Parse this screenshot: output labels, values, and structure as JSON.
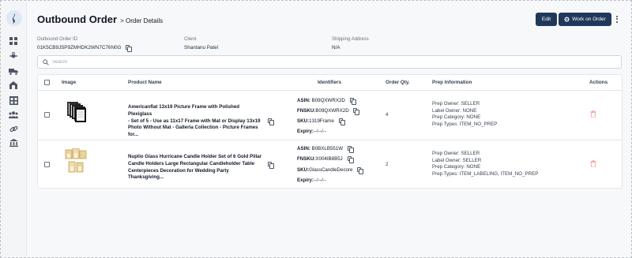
{
  "header": {
    "title": "Outbound Order",
    "subtitle": "> Order Details",
    "edit_label": "Edit",
    "work_label": "Work on Order"
  },
  "info": {
    "order_id_label": "Outbound Order ID",
    "order_id": "01K5CB9JSP9ZMHDK2WN7C76N0G",
    "client_label": "Client",
    "client": "Shantanu Patel",
    "address_label": "Shipping Address",
    "address": "N/A"
  },
  "search": {
    "placeholder": "Search"
  },
  "table": {
    "columns": [
      "Image",
      "Product Name",
      "Identifiers",
      "Order Qty.",
      "Prep Information",
      "Actions"
    ],
    "rows": [
      {
        "name_lines": [
          "Americanflat 13x19 Picture Frame with Polished Plexiglass",
          "- Set of 5 - Use as 11x17 Frame with Mat or Display 13x19",
          "Photo Without Mat - Galleria Collection - Picture Frames for..."
        ],
        "asin_label": "ASIN:",
        "asin": "B09QXWRX2D",
        "fnsku_label": "FNSKU:",
        "fnsku": "B09QXWRX2D",
        "sku_label": "SKU:",
        "sku": "1319Frame",
        "expiry_label": "Expiry:",
        "expiry": "--/--/--",
        "qty": "4",
        "prep": [
          "Prep Owner: SELLER",
          "Label Owner: NONE",
          "Prep Category: NONE",
          "Prep Types: ITEM_NO_PREP"
        ]
      },
      {
        "name_lines": [
          "Nuptio Glass Hurricane Candle Holder Set of 6 Gold Pillar",
          "Candle Holders Large Rectangular Candleholder Table",
          "Centerpieces Decoration for Wedding Party Thanksgiving..."
        ],
        "asin_label": "ASIN:",
        "asin": "B0BXLB551W",
        "fnsku_label": "FNSKU:",
        "fnsku": "X004IB8B5J",
        "sku_label": "SKU:",
        "sku": "GlassCandleDecore",
        "expiry_label": "Expiry:",
        "expiry": "--/--/--",
        "qty": "2",
        "prep": [
          "Prep Owner: SELLER",
          "Label Owner: SELLER",
          "Prep Category: NONE",
          "Prep Types: ITEM_LABELING, ITEM_NO_PREP"
        ]
      }
    ]
  },
  "icons": {
    "sidebar": [
      "dashboard-icon",
      "routing-icon",
      "truck-icon",
      "inventory-icon",
      "warehouse-icon",
      "users-icon",
      "link-icon",
      "bank-icon"
    ],
    "accent": "#20395b",
    "trash_color": "#f0a9a0"
  }
}
